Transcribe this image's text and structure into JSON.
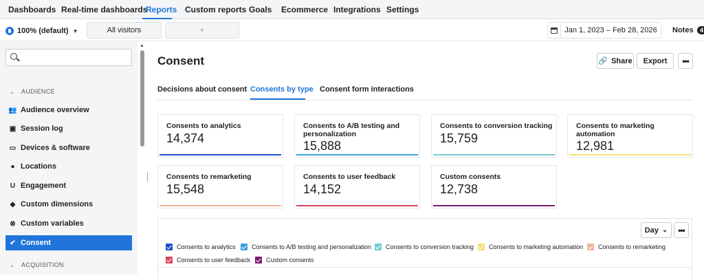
{
  "topnav": {
    "items": [
      {
        "label": "Dashboards",
        "active": false
      },
      {
        "label": "Real-time dashboards",
        "active": false
      },
      {
        "label": "Reports",
        "active": true
      },
      {
        "label": "Custom reports",
        "active": false
      },
      {
        "label": "Goals",
        "active": false
      },
      {
        "label": "Ecommerce",
        "active": false
      },
      {
        "label": "Integrations",
        "active": false
      },
      {
        "label": "Settings",
        "active": false
      }
    ]
  },
  "toolbar": {
    "site_label": "100% (default)",
    "segment_label": "All visitors",
    "add_segment": "+",
    "date_range": "Jan 1, 2023 – Feb 28, 2026",
    "notes_label": "Notes",
    "notes_count": "4"
  },
  "sidebar": {
    "search_placeholder": "",
    "sections": {
      "audience": "AUDIENCE",
      "acquisition": "ACQUISITION"
    },
    "items": [
      {
        "label": "Audience overview",
        "icon": "people-icon"
      },
      {
        "label": "Session log",
        "icon": "session-log-icon"
      },
      {
        "label": "Devices & software",
        "icon": "device-icon"
      },
      {
        "label": "Locations",
        "icon": "location-pin-icon"
      },
      {
        "label": "Engagement",
        "icon": "magnet-icon"
      },
      {
        "label": "Custom dimensions",
        "icon": "cube-icon"
      },
      {
        "label": "Custom variables",
        "icon": "variable-icon"
      },
      {
        "label": "Consent",
        "icon": "check-circle-icon",
        "active": true
      }
    ]
  },
  "main": {
    "title": "Consent",
    "share_label": "Share",
    "export_label": "Export",
    "more_label": "•••",
    "tabs": [
      {
        "label": "Decisions about consent",
        "active": false
      },
      {
        "label": "Consents by type",
        "active": true
      },
      {
        "label": "Consent form interactions",
        "active": false
      }
    ],
    "cards": [
      {
        "label": "Consents to analytics",
        "value": "14,374",
        "color": "#1f4fcf"
      },
      {
        "label": "Consents to A/B testing and personalization",
        "value": "15,888",
        "color": "#3aa0e0"
      },
      {
        "label": "Consents to conversion tracking",
        "value": "15,759",
        "color": "#6fcfd3"
      },
      {
        "label": "Consents to marketing automation",
        "value": "12,981",
        "color": "#f3e07a"
      },
      {
        "label": "Consents to remarketing",
        "value": "15,548",
        "color": "#f2b39a"
      },
      {
        "label": "Consents to user feedback",
        "value": "14,152",
        "color": "#d9455f"
      },
      {
        "label": "Custom consents",
        "value": "12,738",
        "color": "#7a1d6f"
      }
    ],
    "chart": {
      "interval_label": "Day",
      "interval_chevron": "⌄",
      "more_label": "•••",
      "legend": [
        {
          "label": "Consents to analytics",
          "color": "#1f4fcf"
        },
        {
          "label": "Consents to A/B testing and personalization",
          "color": "#3aa0e0"
        },
        {
          "label": "Consents to conversion tracking",
          "color": "#6fcfd3"
        },
        {
          "label": "Consents to marketing automation",
          "color": "#f3e07a"
        },
        {
          "label": "Consents to remarketing",
          "color": "#f2b39a"
        },
        {
          "label": "Consents to user feedback",
          "color": "#d9455f"
        },
        {
          "label": "Custom consents",
          "color": "#7a1d6f"
        }
      ]
    }
  }
}
